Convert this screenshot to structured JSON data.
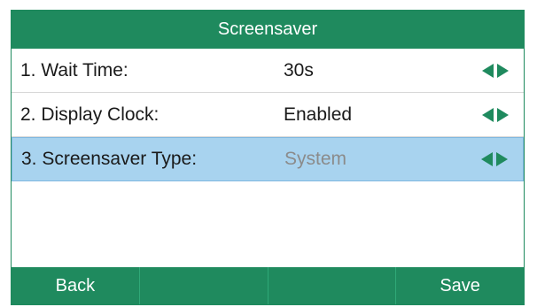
{
  "title": "Screensaver",
  "rows": [
    {
      "label": "1. Wait Time:",
      "value": "30s"
    },
    {
      "label": "2. Display Clock:",
      "value": "Enabled"
    },
    {
      "label": "3. Screensaver Type:",
      "value": "System"
    }
  ],
  "softkeys": [
    "Back",
    "",
    "",
    "Save"
  ],
  "colors": {
    "accent": "#1f8a5e",
    "selected_row": "#a8d3ef"
  },
  "icons": {
    "left": "left-arrow-icon",
    "right": "right-arrow-icon"
  }
}
